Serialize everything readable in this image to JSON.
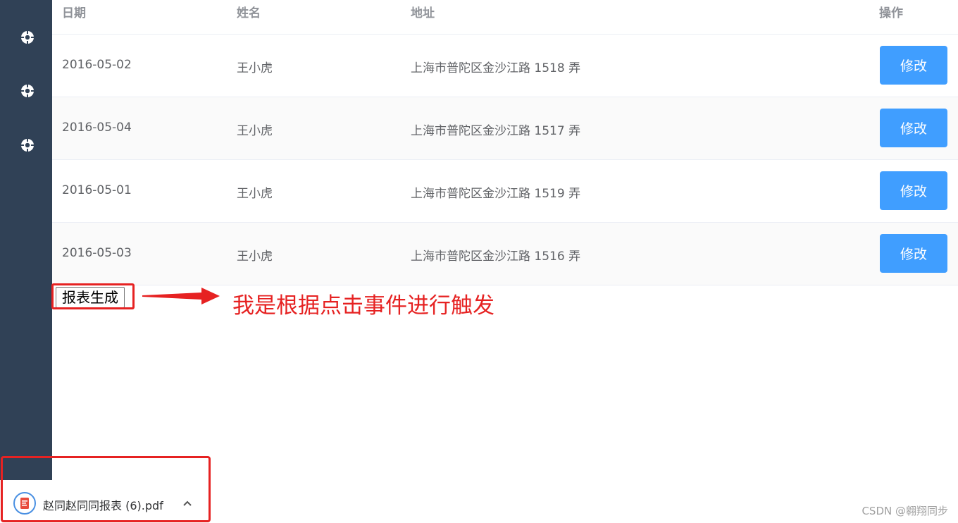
{
  "sidebar": {
    "icons": [
      "target-icon",
      "target-icon",
      "target-icon"
    ]
  },
  "table": {
    "headers": {
      "date": "日期",
      "name": "姓名",
      "address": "地址",
      "operation": "操作"
    },
    "rows": [
      {
        "date": "2016-05-02",
        "name": "王小虎",
        "address": "上海市普陀区金沙江路 1518 弄",
        "action": "修改"
      },
      {
        "date": "2016-05-04",
        "name": "王小虎",
        "address": "上海市普陀区金沙江路 1517 弄",
        "action": "修改"
      },
      {
        "date": "2016-05-01",
        "name": "王小虎",
        "address": "上海市普陀区金沙江路 1519 弄",
        "action": "修改"
      },
      {
        "date": "2016-05-03",
        "name": "王小虎",
        "address": "上海市普陀区金沙江路 1516 弄",
        "action": "修改"
      }
    ]
  },
  "report_button": {
    "label": "报表生成"
  },
  "annotation": {
    "text": "我是根据点击事件进行触发",
    "color": "#e62222"
  },
  "download": {
    "file_name": "赵同赵同同报表 (6).pdf",
    "icon": "pdf-file-icon"
  },
  "watermark": {
    "text": "CSDN @翱翔同步"
  },
  "colors": {
    "sidebar": "#304156",
    "primary": "#409eff",
    "annotation_red": "#e62222"
  }
}
